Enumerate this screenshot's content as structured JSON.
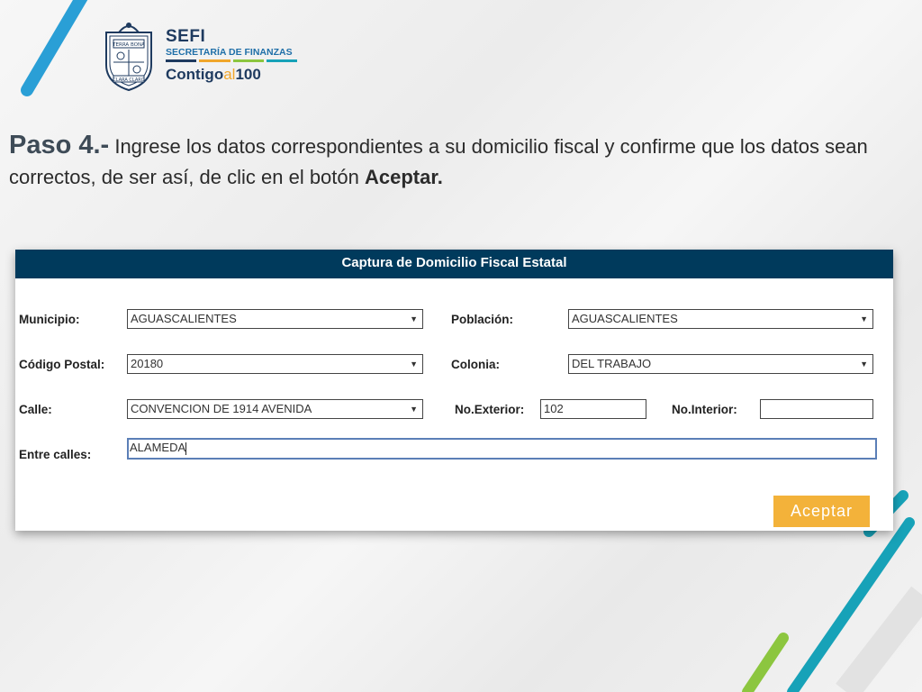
{
  "logo": {
    "seal_text_top": "TERRA BONA",
    "seal_text_bottom": "CLARA CLARO",
    "org_short": "SEFI",
    "org_full": "SECRETARÍA DE FINANZAS",
    "slogan_part1": "Contigo",
    "slogan_part2": "al",
    "slogan_part3": "100",
    "colors": {
      "navy": "#1e3a5f",
      "blue": "#1f6fa8",
      "orange": "#f0a62b",
      "green": "#8cc63f",
      "teal": "#17a2b8"
    }
  },
  "instruction": {
    "step": "Paso 4.-",
    "text": " Ingrese los datos correspondientes a su domicilio fiscal y confirme que los datos sean correctos, de ser así, de clic en el botón ",
    "action": "Aceptar."
  },
  "form": {
    "title": "Captura de Domicilio Fiscal Estatal",
    "municipio_label": "Municipio:",
    "municipio_value": "AGUASCALIENTES",
    "poblacion_label": "Población:",
    "poblacion_value": "AGUASCALIENTES",
    "cp_label": "Código Postal:",
    "cp_value": "20180",
    "colonia_label": "Colonia:",
    "colonia_value": "DEL TRABAJO",
    "calle_label": "Calle:",
    "calle_value": "CONVENCION DE 1914 AVENIDA",
    "no_exterior_label": "No.Exterior:",
    "no_exterior_value": "102",
    "no_interior_label": "No.Interior:",
    "no_interior_value": "",
    "entre_calles_label": "Entre calles:",
    "entre_calles_value": "ALAMEDA",
    "submit_label": "Aceptar",
    "dropdown_arrow": "▼",
    "colors": {
      "header": "#003a5c",
      "button": "#f3b23a"
    }
  }
}
